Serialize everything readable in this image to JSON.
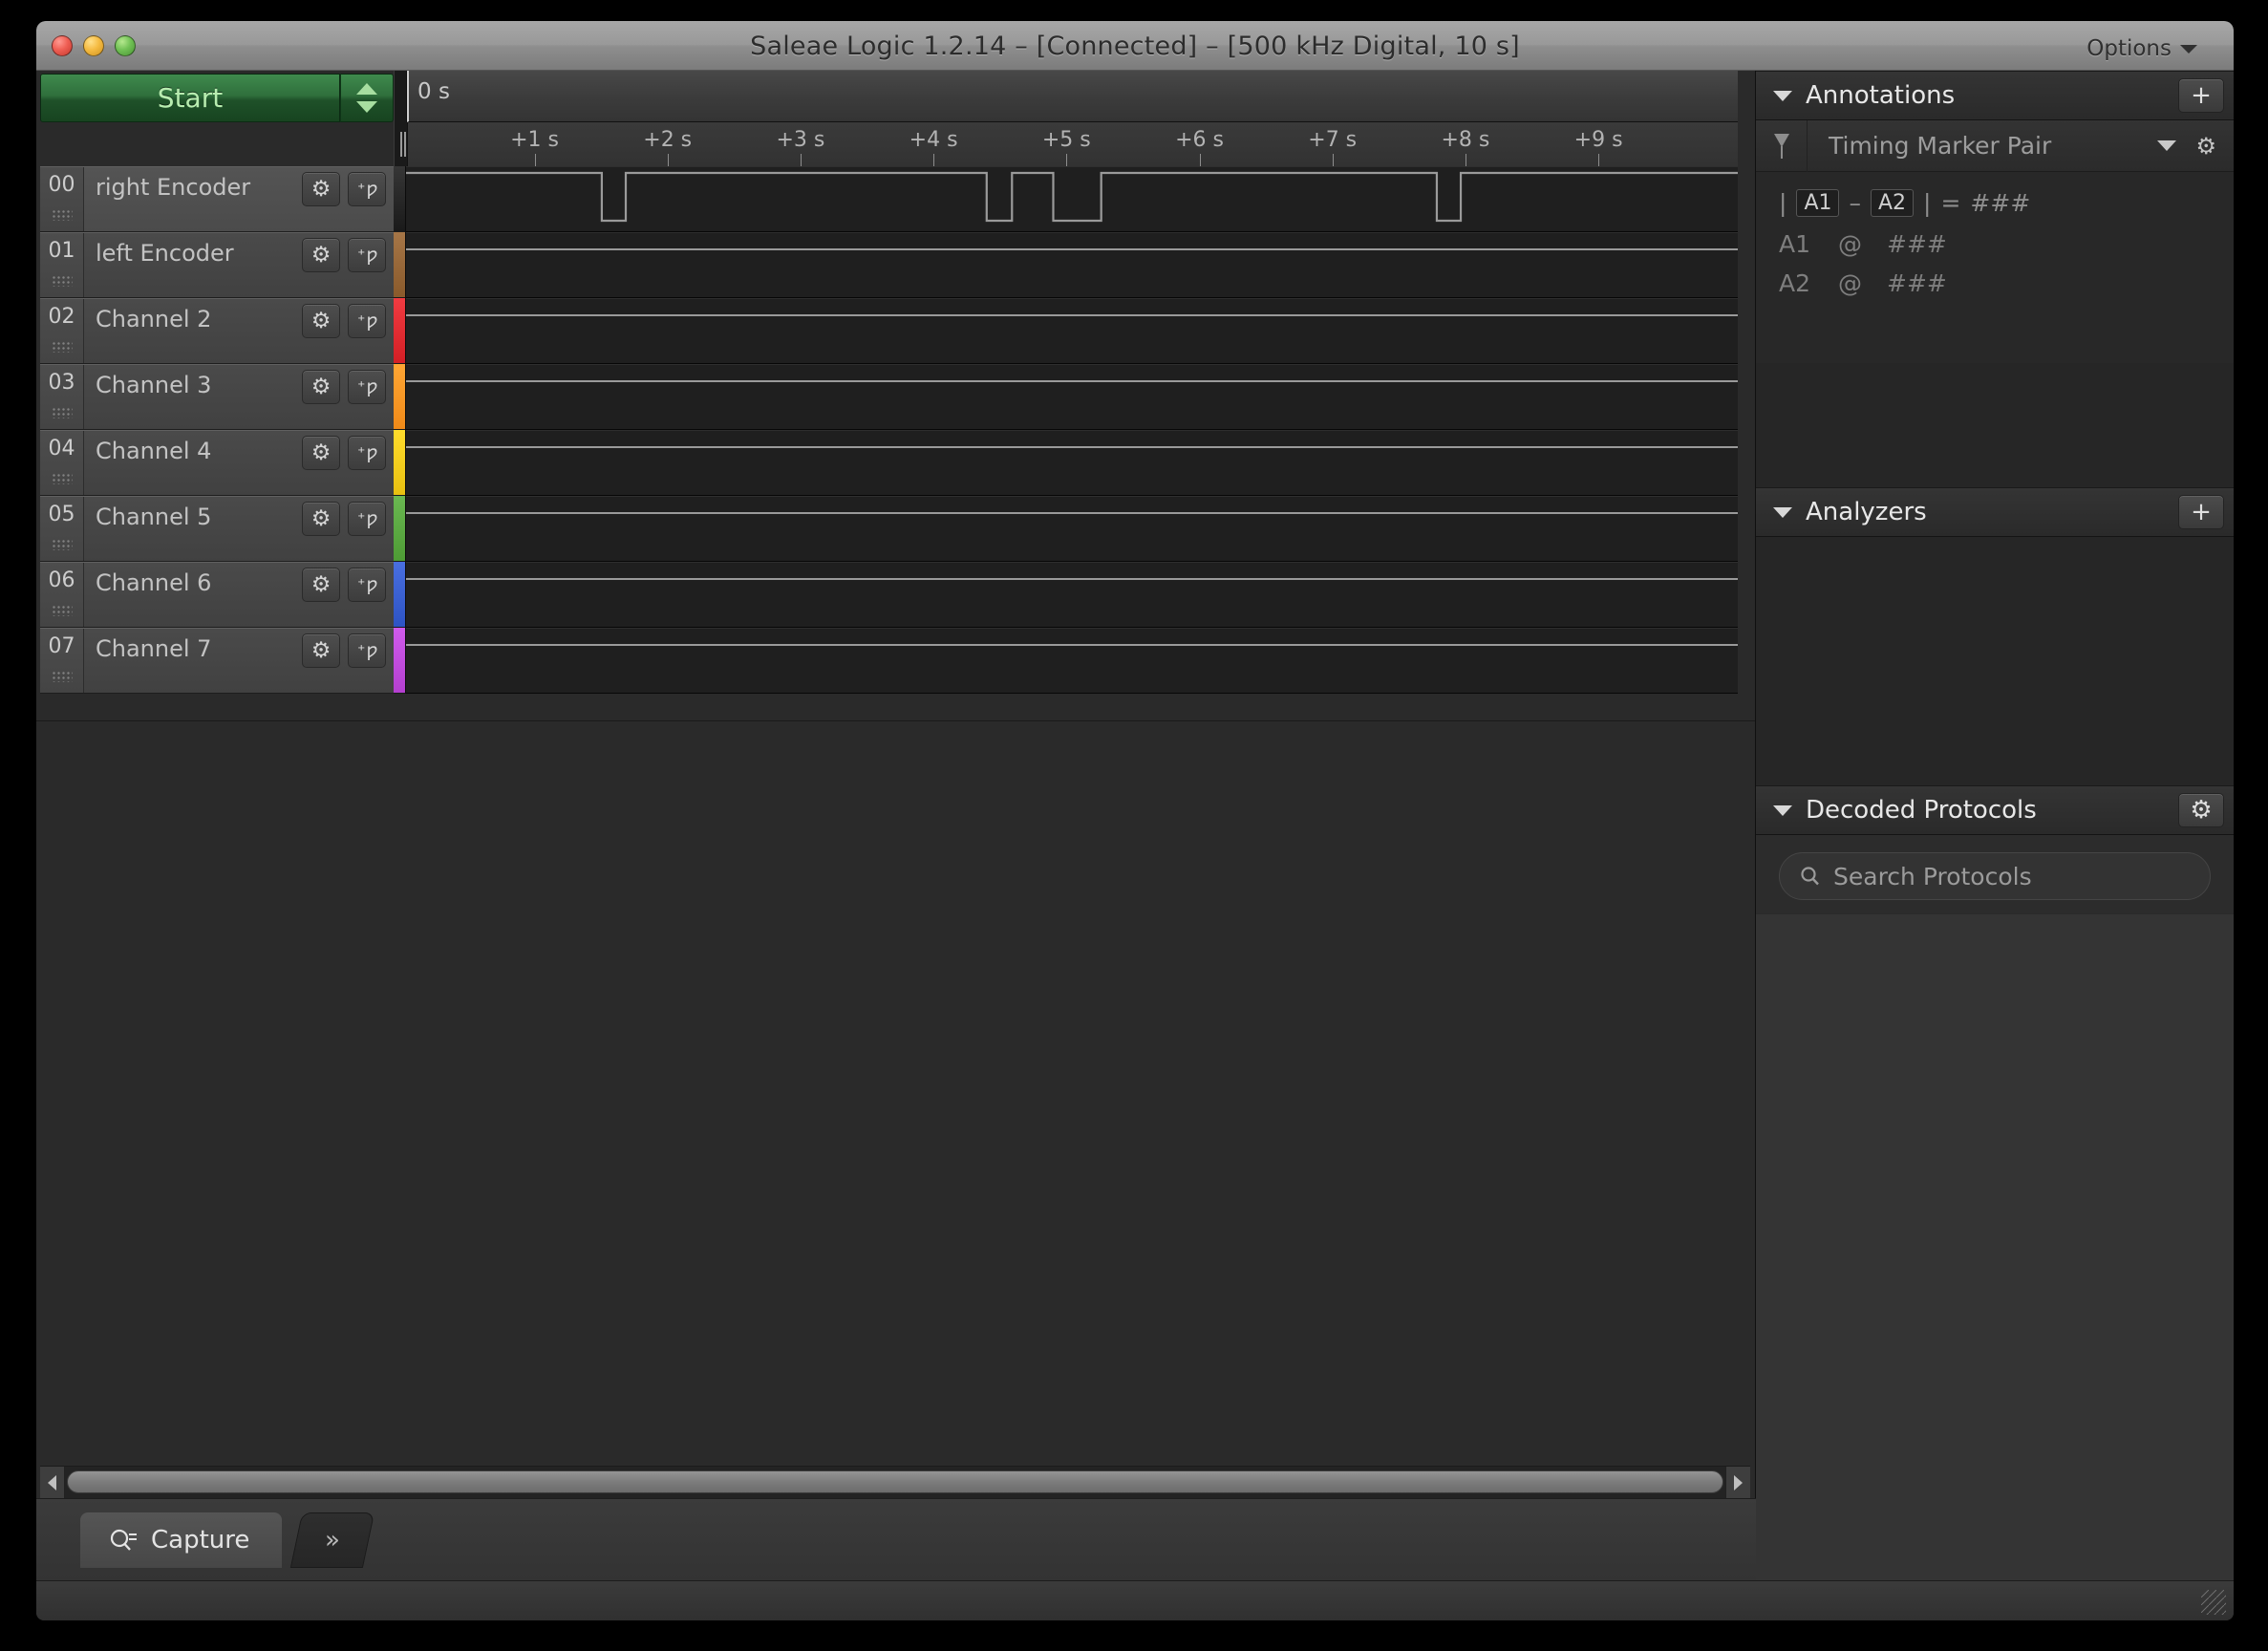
{
  "window": {
    "title": "Saleae Logic 1.2.14 – [Connected] – [500 kHz Digital, 10 s]",
    "options_label": "Options",
    "traffic_lights": [
      "close-button",
      "minimize-button",
      "zoom-button"
    ]
  },
  "toolbar": {
    "start_label": "Start",
    "start_up_icon": "triangle-up-icon",
    "start_down_icon": "triangle-down-icon"
  },
  "timeline": {
    "origin_label": "0 s",
    "ticks": [
      {
        "label": "+1 s",
        "pos_pct": 9.52
      },
      {
        "label": "+2 s",
        "pos_pct": 19.52
      },
      {
        "label": "+3 s",
        "pos_pct": 29.52
      },
      {
        "label": "+4 s",
        "pos_pct": 39.52
      },
      {
        "label": "+5 s",
        "pos_pct": 49.52
      },
      {
        "label": "+6 s",
        "pos_pct": 59.52
      },
      {
        "label": "+7 s",
        "pos_pct": 69.52
      },
      {
        "label": "+8 s",
        "pos_pct": 79.52
      },
      {
        "label": "+9 s",
        "pos_pct": 89.52
      }
    ]
  },
  "channels": [
    {
      "num": "00",
      "name": "right Encoder",
      "color": "#1a1a1a",
      "selected": true,
      "waveform": [
        {
          "t": 0.0,
          "v": 1
        },
        {
          "t": 14.7,
          "v": 0
        },
        {
          "t": 16.5,
          "v": 1
        },
        {
          "t": 43.6,
          "v": 0
        },
        {
          "t": 45.5,
          "v": 1
        },
        {
          "t": 48.6,
          "v": 0
        },
        {
          "t": 52.2,
          "v": 1
        },
        {
          "t": 77.4,
          "v": 0
        },
        {
          "t": 79.2,
          "v": 1
        },
        {
          "t": 100.0,
          "v": 1
        }
      ]
    },
    {
      "num": "01",
      "name": "left Encoder",
      "color": "#8a5a2b",
      "selected": false,
      "waveform": []
    },
    {
      "num": "02",
      "name": "Channel 2",
      "color": "#d41f25",
      "selected": false,
      "waveform": []
    },
    {
      "num": "03",
      "name": "Channel 3",
      "color": "#f08a18",
      "selected": false,
      "waveform": []
    },
    {
      "num": "04",
      "name": "Channel 4",
      "color": "#e8c010",
      "selected": false,
      "waveform": []
    },
    {
      "num": "05",
      "name": "Channel 5",
      "color": "#4e9c35",
      "selected": false,
      "waveform": []
    },
    {
      "num": "06",
      "name": "Channel 6",
      "color": "#2d53c4",
      "selected": false,
      "waveform": []
    },
    {
      "num": "07",
      "name": "Channel 7",
      "color": "#b43fd0",
      "selected": false,
      "waveform": []
    }
  ],
  "channel_row_icons": {
    "settings": "gear-icon",
    "trigger": "trigger-add-icon"
  },
  "annotations": {
    "title": "Annotations",
    "add_label": "+",
    "pin_icon": "pin-icon",
    "selected_annotation": "Timing Marker Pair",
    "gear_icon": "gear-icon",
    "caret_icon": "chevron-down-icon",
    "delta_prefix": "|",
    "marker_a": "A1",
    "delta_dash": "–",
    "marker_b": "A2",
    "delta_suffix": "|",
    "equals": "=",
    "delta_value": "###",
    "rows": [
      {
        "label": "A1",
        "at": "@",
        "value": "###"
      },
      {
        "label": "A2",
        "at": "@",
        "value": "###"
      }
    ]
  },
  "analyzers": {
    "title": "Analyzers",
    "add_label": "+"
  },
  "decoded_protocols": {
    "title": "Decoded Protocols",
    "gear_icon": "gear-icon",
    "search_placeholder": "Search Protocols",
    "search_value": "",
    "search_icon": "magnifier-icon"
  },
  "bottom": {
    "capture_tab_label": "Capture",
    "capture_icon": "magnifier-list-icon",
    "expand_label": "»",
    "scroll_left_icon": "arrow-left-icon",
    "scroll_right_icon": "arrow-right-icon"
  },
  "colors": {
    "accent_green": "#2f6f3c",
    "panel_bg": "#2c2c2c",
    "wave_bg": "#1f1f1f",
    "wave_line": "#9a9a9a"
  }
}
